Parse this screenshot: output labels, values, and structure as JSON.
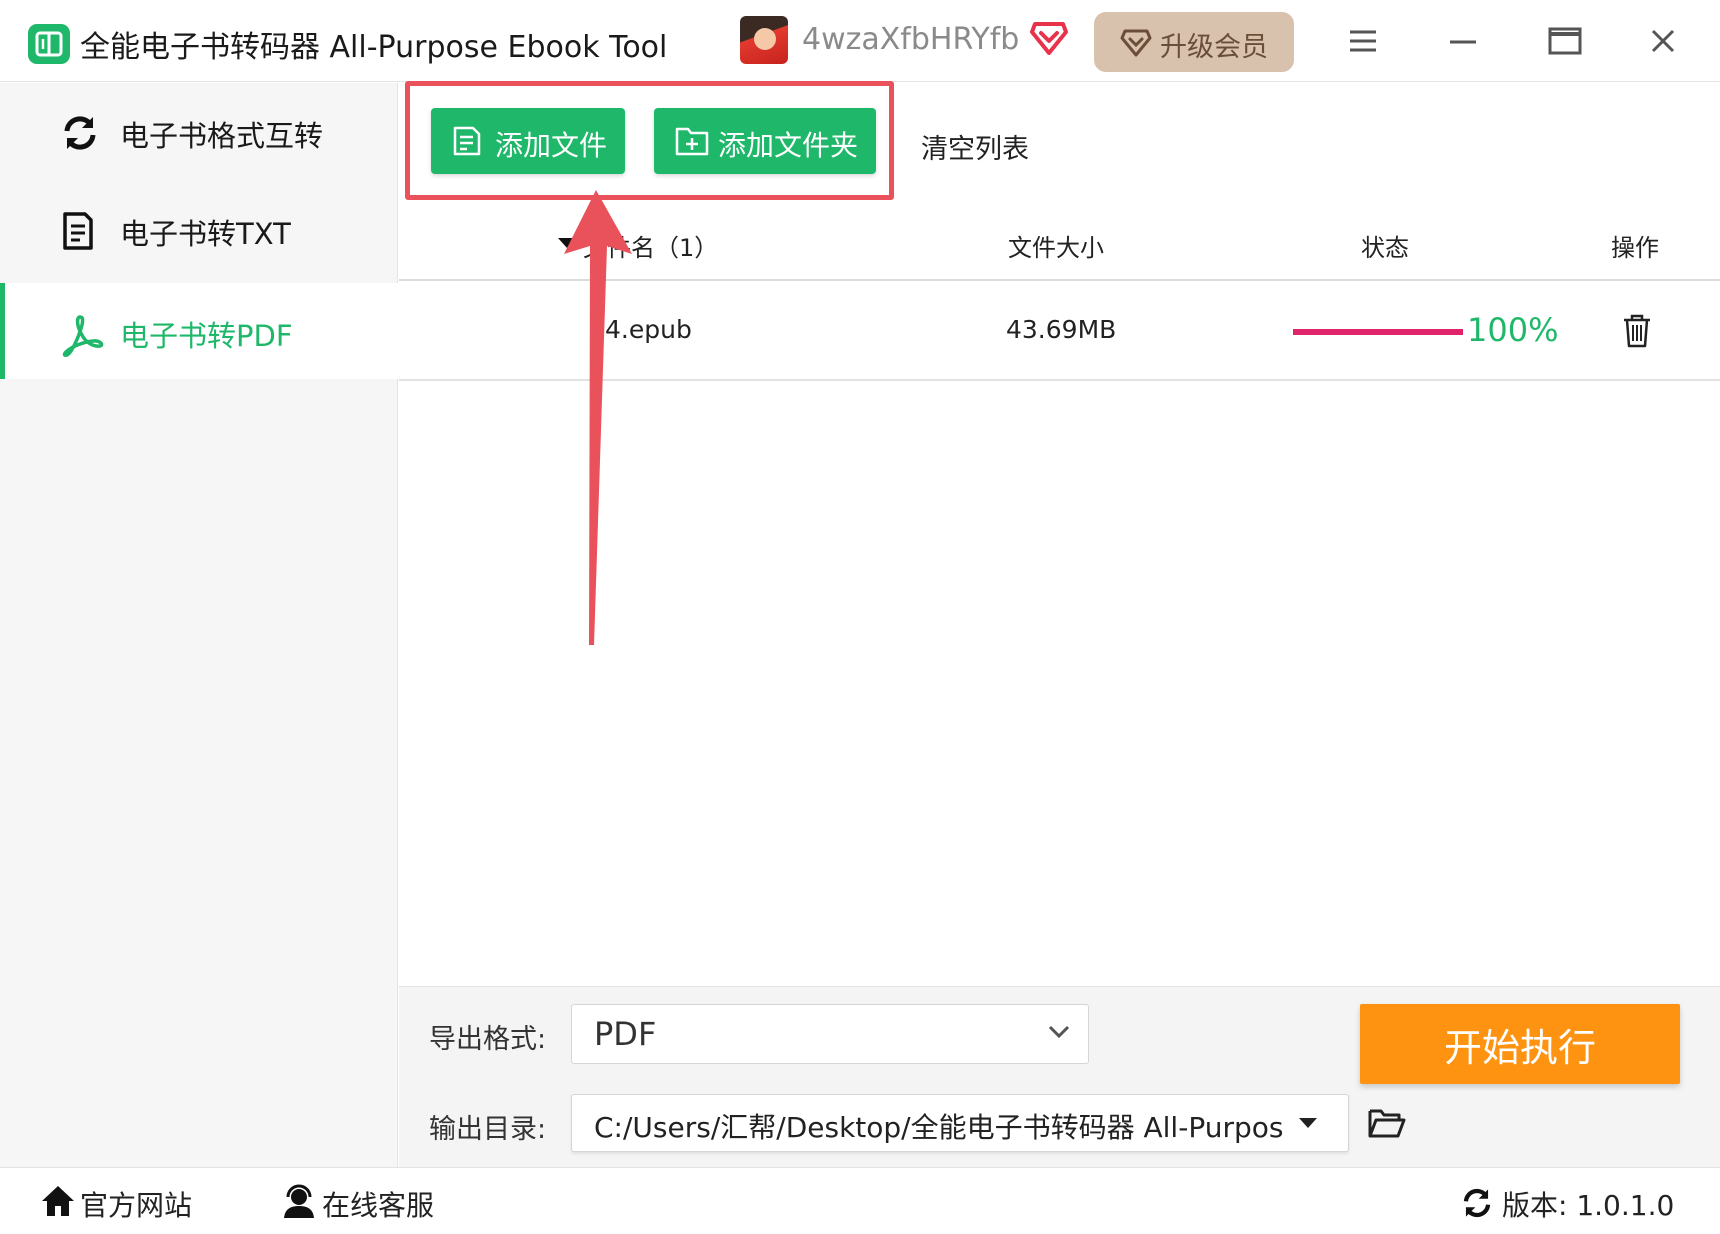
{
  "titlebar": {
    "app_title": "全能电子书转码器 All-Purpose Ebook Tool",
    "username": "4wzaXfbHRYfb",
    "upgrade_label": "升级会员"
  },
  "sidebar": {
    "items": [
      {
        "label": "电子书格式互转",
        "icon": "refresh-icon",
        "active": false
      },
      {
        "label": "电子书转TXT",
        "icon": "document-icon",
        "active": false
      },
      {
        "label": "电子书转PDF",
        "icon": "pdf-icon",
        "active": true
      }
    ]
  },
  "toolbar": {
    "add_file_label": "添加文件",
    "add_folder_label": "添加文件夹",
    "clear_label": "清空列表"
  },
  "table": {
    "headers": {
      "filename": "文件名（1）",
      "filesize": "文件大小",
      "status": "状态",
      "actions": "操作"
    },
    "rows": [
      {
        "filename": "4.epub",
        "filesize": "43.69MB",
        "progress": 1.0,
        "progress_label": "100%"
      }
    ]
  },
  "settings": {
    "format_label": "导出格式:",
    "format_value": "PDF",
    "dir_label": "输出目录:",
    "dir_value": "C:/Users/汇帮/Desktop/全能电子书转码器 All-Purpose Ebook Tool",
    "start_label": "开始执行"
  },
  "footer": {
    "website_label": "官方网站",
    "support_label": "在线客服",
    "version_label": "版本: 1.0.1.0"
  },
  "colors": {
    "accent": "#1fb86a",
    "start_button": "#fd9311",
    "progress": "#e0246b",
    "annotation": "#e9525a",
    "upgrade_bg": "#d9c2ad"
  }
}
